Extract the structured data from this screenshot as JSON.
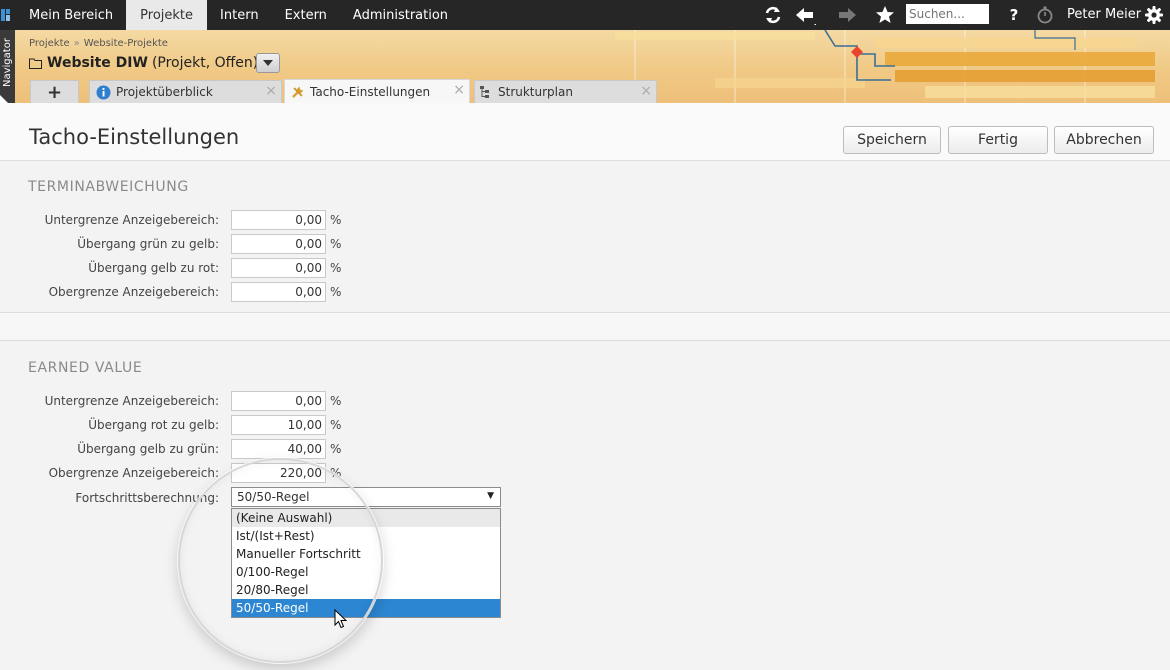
{
  "topbar": {
    "nav": [
      "Mein Bereich",
      "Projekte",
      "Intern",
      "Extern",
      "Administration"
    ],
    "active_nav": "Projekte",
    "search_placeholder": "Suchen...",
    "help_label": "?",
    "user_name": "Peter Meier",
    "icons": [
      "refresh-icon",
      "back-arrow-icon",
      "forward-arrow-icon",
      "star-icon",
      "help-icon",
      "stopwatch-icon",
      "gear-icon"
    ]
  },
  "navigator": {
    "label": "Navigator"
  },
  "project": {
    "breadcrumb": [
      "Projekte",
      "Website-Projekte"
    ],
    "breadcrumb_sep": "»",
    "title": "Website DIW",
    "subtitle": "(Projekt, Offen)"
  },
  "tabs": [
    {
      "label": "Projektüberblick",
      "icon": "info-icon"
    },
    {
      "label": "Tacho-Einstellungen",
      "icon": "tools-icon",
      "active": true
    },
    {
      "label": "Strukturplan",
      "icon": "structure-icon"
    }
  ],
  "tab_add_label": "+",
  "tab_close": "×",
  "page": {
    "title": "Tacho-Einstellungen",
    "buttons": {
      "save": "Speichern",
      "done": "Fertig",
      "cancel": "Abbrechen"
    }
  },
  "terminabweichung": {
    "title": "TERMINABWEICHUNG",
    "rows": [
      {
        "label": "Untergrenze Anzeigebereich:",
        "value": "0,00",
        "unit": "%"
      },
      {
        "label": "Übergang grün zu gelb:",
        "value": "0,00",
        "unit": "%"
      },
      {
        "label": "Übergang gelb zu rot:",
        "value": "0,00",
        "unit": "%"
      },
      {
        "label": "Obergrenze Anzeigebereich:",
        "value": "0,00",
        "unit": "%"
      }
    ]
  },
  "earned_value": {
    "title": "EARNED VALUE",
    "rows": [
      {
        "label": "Untergrenze Anzeigebereich:",
        "value": "0,00",
        "unit": "%"
      },
      {
        "label": "Übergang rot zu gelb:",
        "value": "10,00",
        "unit": "%"
      },
      {
        "label": "Übergang gelb zu grün:",
        "value": "40,00",
        "unit": "%"
      },
      {
        "label": "Obergrenze Anzeigebereich:",
        "value": "220,00",
        "unit": "%"
      }
    ],
    "progress": {
      "label": "Fortschrittsberechnung:",
      "selected": "50/50-Regel",
      "arrow": "▼",
      "options": [
        "(Keine Auswahl)",
        "Ist/(Ist+Rest)",
        "Manueller Fortschritt",
        "0/100-Regel",
        "20/80-Regel",
        "50/50-Regel"
      ]
    }
  },
  "colors": {
    "topbar_bg": "#262626",
    "header_bg": "#f0c985",
    "selection": "#2c86d1",
    "accent_red": "#e8452c"
  }
}
